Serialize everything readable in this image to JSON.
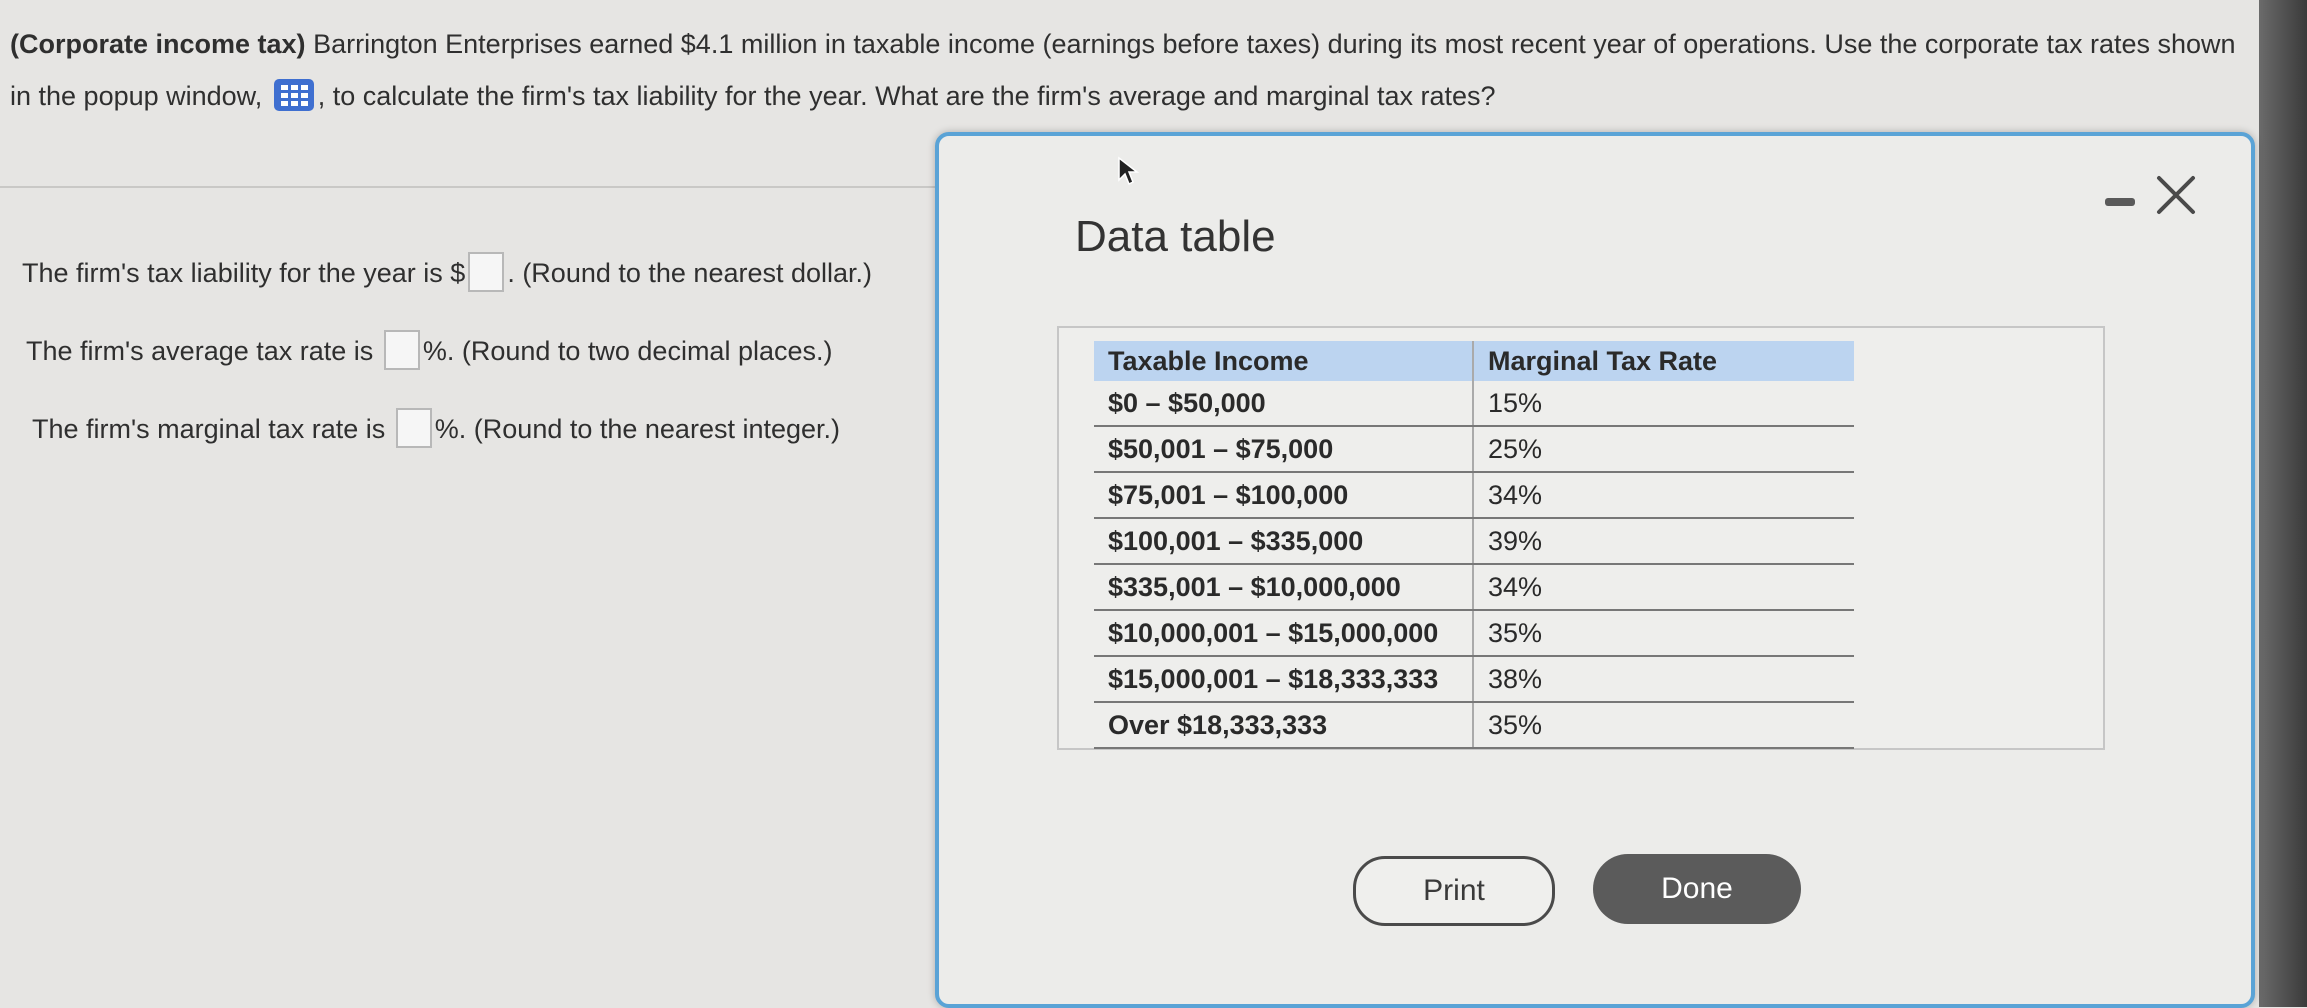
{
  "question": {
    "prefix_bold": "(Corporate income tax)",
    "text_before_icon": "Barrington Enterprises earned $4.1 million in taxable income (earnings before taxes) during its most recent year of operations. Use the corporate tax rates shown in the popup window,",
    "icon": "table-grid-icon",
    "text_after_icon": ", to calculate the firm's tax liability for the year. What are the firm's average and marginal tax rates?"
  },
  "answers": {
    "liability": {
      "before": "The firm's tax liability for the year is $",
      "value": "",
      "after": ". (Round to the nearest dollar.)"
    },
    "average": {
      "before": "The firm's average tax rate is",
      "value": "",
      "after": "%. (Round to two decimal places.)"
    },
    "marginal": {
      "before": "The firm's marginal tax rate is",
      "value": "",
      "after": "%. (Round to the nearest integer.)"
    }
  },
  "popup": {
    "title": "Data table",
    "minimize_icon": "minimize-icon",
    "close_icon": "close-icon",
    "table": {
      "headers": [
        "Taxable Income",
        "Marginal Tax Rate"
      ],
      "rows": [
        [
          "$0 – $50,000",
          "15%"
        ],
        [
          "$50,001 – $75,000",
          "25%"
        ],
        [
          "$75,001 – $100,000",
          "34%"
        ],
        [
          "$100,001 – $335,000",
          "39%"
        ],
        [
          "$335,001 – $10,000,000",
          "34%"
        ],
        [
          "$10,000,001 – $15,000,000",
          "35%"
        ],
        [
          "$15,000,001 – $18,333,333",
          "38%"
        ],
        [
          "Over $18,333,333",
          "35%"
        ]
      ]
    },
    "print_label": "Print",
    "done_label": "Done"
  },
  "colors": {
    "popup_border": "#5aa3d6",
    "table_header": "#bcd4f0",
    "done_button": "#5b5b5b",
    "calc_icon": "#3f6fd0"
  }
}
